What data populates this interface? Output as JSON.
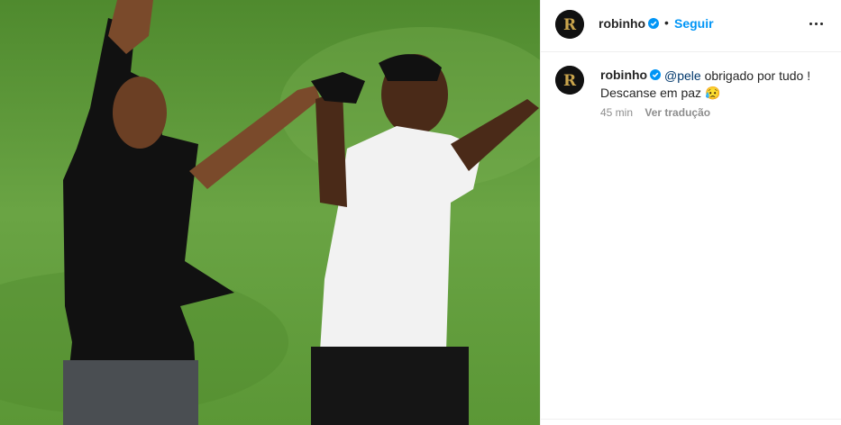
{
  "post": {
    "image_alt": "",
    "author": "robinho",
    "follow_label": "Seguir",
    "separator": "•"
  },
  "comment": {
    "author": "robinho",
    "mention": "@pele",
    "text": "obrigado por tudo ! Descanse em paz",
    "emoji": "😥",
    "time": "45 min",
    "translate_label": "Ver tradução"
  },
  "icons": {
    "verified": "verified-badge-icon",
    "more": "more-options-icon"
  },
  "colors": {
    "accent": "#0095f6",
    "text": "#262626",
    "muted": "#8e8e8e",
    "mention": "#00376b"
  }
}
